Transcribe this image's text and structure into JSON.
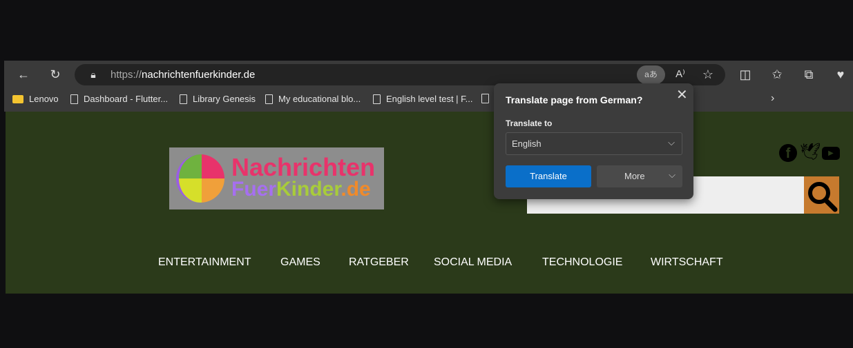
{
  "browser": {
    "url_prefix": "https://",
    "url_domain": "nachrichtenfuerkinder.de",
    "bookmarks": [
      {
        "label": "Lenovo",
        "icon": "folder-icon"
      },
      {
        "label": "Dashboard - Flutter...",
        "icon": "page-icon"
      },
      {
        "label": "Library Genesis",
        "icon": "page-icon"
      },
      {
        "label": "My educational blo...",
        "icon": "page-icon"
      },
      {
        "label": "English level test | F...",
        "icon": "page-icon"
      }
    ]
  },
  "site": {
    "logo_line1": "Nachrichten",
    "logo_line2a": "Fuer",
    "logo_line2b": "Kinder",
    ".de": ".de",
    "logo_line2c": ".de",
    "nav": [
      "ENTERTAINMENT",
      "GAMES",
      "RATGEBER",
      "SOCIAL MEDIA",
      "TECHNOLOGIE",
      "WIRTSCHAFT"
    ],
    "social": [
      "facebook-icon",
      "twitter-icon",
      "youtube-icon"
    ],
    "search_accent": "#c67a2e"
  },
  "translate_popup": {
    "title": "Translate page from German?",
    "label": "Translate to",
    "selected_language": "English",
    "translate_button": "Translate",
    "more_button": "More",
    "accent": "#0a6fc9"
  }
}
